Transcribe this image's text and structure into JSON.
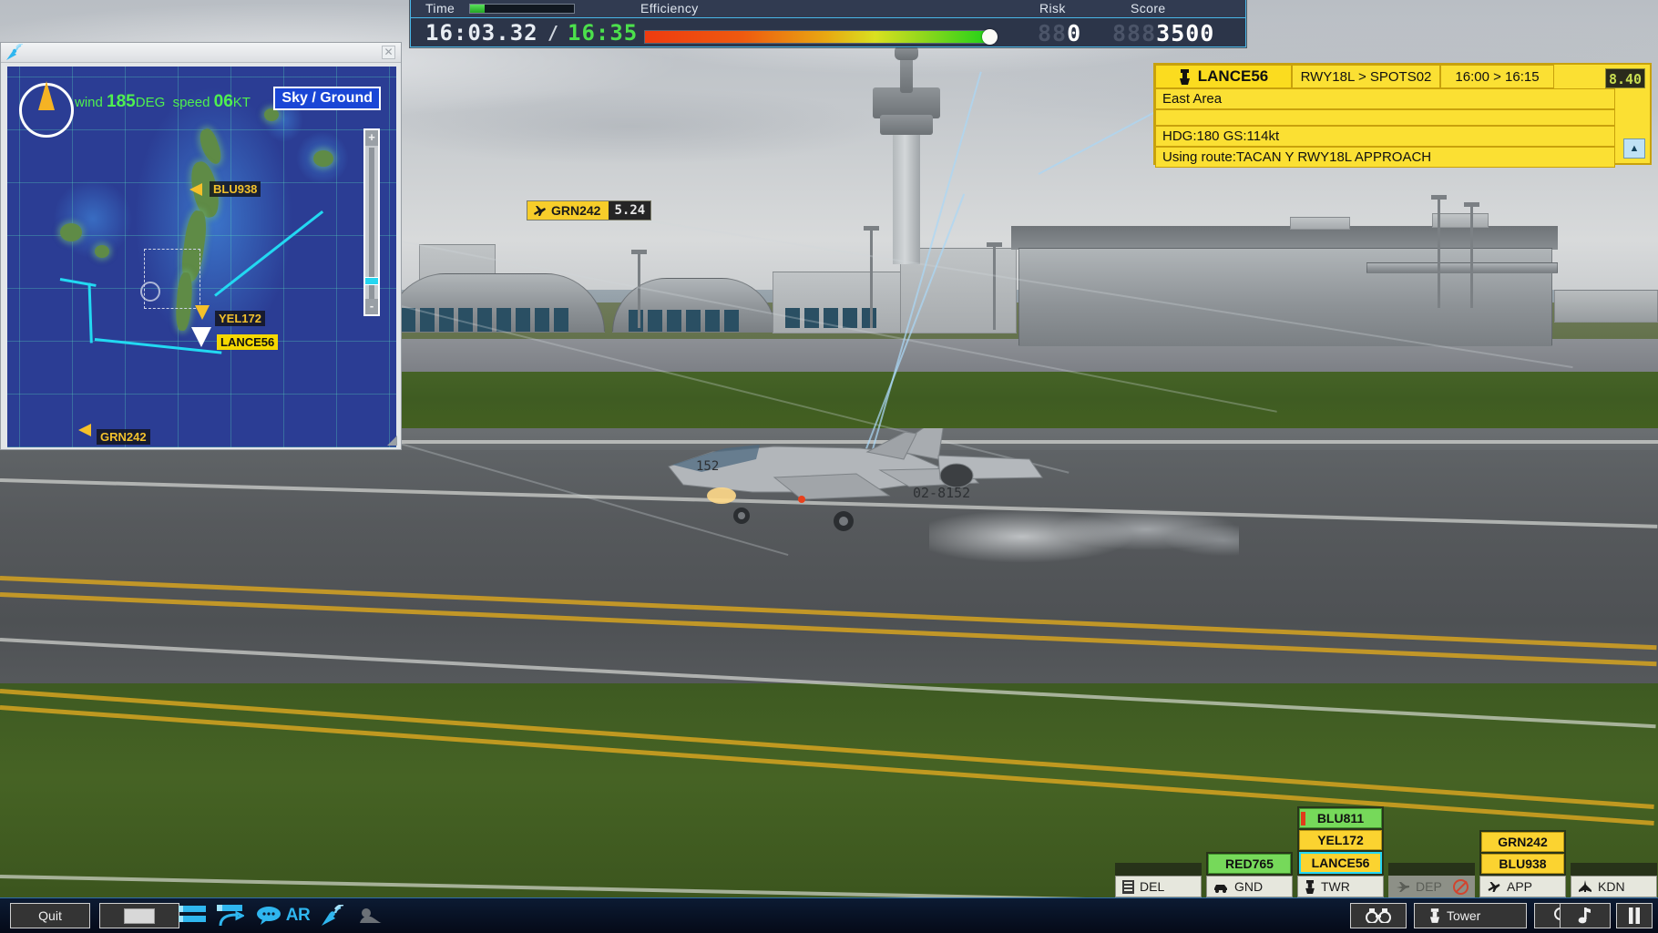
{
  "hud": {
    "time_label": "Time",
    "efficiency_label": "Efficiency",
    "risk_label": "Risk",
    "score_label": "Score",
    "time_current": "16:03.32",
    "time_separator": "/",
    "time_target": "16:35",
    "time_bar_percent": 10,
    "efficiency_percent": 96,
    "risk_dim": "88",
    "risk_value": "0",
    "score_dim": "888",
    "score_value": "3500"
  },
  "radar": {
    "window_icon": "radar-dish-icon",
    "close_icon": "close-icon",
    "wind_prefix": "wind",
    "wind_deg": "185",
    "wind_deg_unit": "DEG",
    "speed_prefix": "speed",
    "speed_value": "06",
    "speed_unit": "KT",
    "sky_ground_label": "Sky / Ground",
    "zoom_in_label": "+",
    "zoom_out_label": "-",
    "contacts": [
      {
        "callsign": "BLU938",
        "selected": false
      },
      {
        "callsign": "YEL172",
        "selected": false
      },
      {
        "callsign": "LANCE56",
        "selected": true
      },
      {
        "callsign": "GRN242",
        "selected": false
      }
    ]
  },
  "strip": {
    "tower_icon": "control-tower-icon",
    "callsign": "LANCE56",
    "route": "RWY18L > SPOTS02",
    "window": "16:00 > 16:15",
    "countdown": "8.40",
    "area": "East Area",
    "blank_row": "",
    "heading_speed": "HDG:180 GS:114kt",
    "using_route": "Using route:TACAN Y RWY18L APPROACH",
    "expand_icon": "triangle-up-icon"
  },
  "scene": {
    "callout": {
      "icon": "departing-aircraft-icon",
      "callsign": "GRN242",
      "value": "5.24"
    },
    "aircraft_tail_number": "02-8152",
    "aircraft_nose_number": "152"
  },
  "board": {
    "columns": [
      {
        "id": "del",
        "label": "DEL",
        "icon": "clearance-list-icon",
        "enabled": true,
        "aircraft": []
      },
      {
        "id": "gnd",
        "label": "GND",
        "icon": "ground-vehicle-icon",
        "enabled": true,
        "aircraft": [
          {
            "callsign": "RED765",
            "color": "g",
            "selected": false,
            "bar": false
          }
        ]
      },
      {
        "id": "twr",
        "label": "TWR",
        "icon": "control-tower-icon",
        "enabled": true,
        "aircraft": [
          {
            "callsign": "BLU811",
            "color": "g",
            "selected": false,
            "bar": true
          },
          {
            "callsign": "YEL172",
            "color": "y",
            "selected": false,
            "bar": false
          },
          {
            "callsign": "LANCE56",
            "color": "y",
            "selected": true,
            "bar": false
          }
        ]
      },
      {
        "id": "dep",
        "label": "DEP",
        "icon": "departure-aircraft-icon",
        "enabled": false,
        "aircraft": []
      },
      {
        "id": "app",
        "label": "APP",
        "icon": "approach-aircraft-icon",
        "enabled": true,
        "aircraft": [
          {
            "callsign": "GRN242",
            "color": "y",
            "selected": false,
            "bar": false
          },
          {
            "callsign": "BLU938",
            "color": "y",
            "selected": false,
            "bar": false
          }
        ]
      },
      {
        "id": "kdn",
        "label": "KDN",
        "icon": "fighter-jet-icon",
        "enabled": true,
        "aircraft": []
      }
    ]
  },
  "toolbar": {
    "quit_label": "Quit",
    "keyboard_icon": "keyboard-icon",
    "strips_icon": "flight-strips-icon",
    "approach-strips_icon": "approach-strips-icon",
    "chat_icon": "chat-bubble-icon",
    "ar_label": "AR",
    "radar_icon": "radar-dish-icon",
    "terrain_icon": "terrain-icon",
    "binoculars_icon": "binoculars-icon",
    "view_label": "Tower",
    "view_icon": "control-tower-icon",
    "search_icon": "search-icon",
    "music_icon": "music-note-icon",
    "pause_icon": "pause-icon"
  },
  "colors": {
    "hud_bg": "#2c3549",
    "hud_border": "#49b7e8",
    "strip_yellow": "#fbe033",
    "selection_cyan": "#25d7f5",
    "radar_blue": "#2b3d94",
    "green_tag": "#76d95a"
  }
}
